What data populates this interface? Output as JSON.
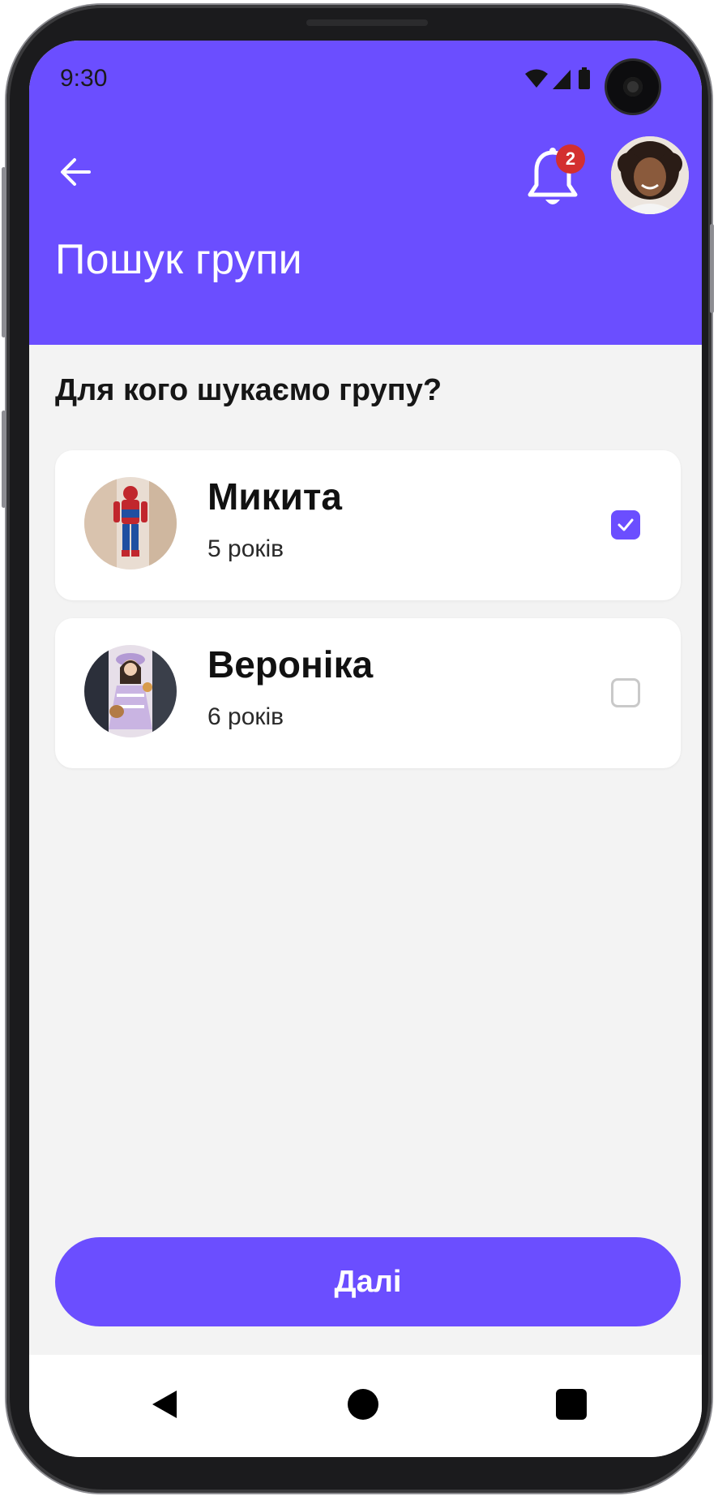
{
  "status_bar": {
    "time": "9:30",
    "icons": [
      "wifi-icon",
      "signal-icon",
      "battery-icon"
    ]
  },
  "header": {
    "title": "Пошук групи",
    "notification_count": "2",
    "background_color": "#6b4eff"
  },
  "content": {
    "question": "Для кого шукаємо групу?",
    "children": [
      {
        "name": "Микита",
        "age": "5 років",
        "selected": true
      },
      {
        "name": "Вероніка",
        "age": "6 років",
        "selected": false
      }
    ]
  },
  "footer": {
    "next_label": "Далі",
    "accent_color": "#6b4eff"
  },
  "navbar": {
    "icons": [
      "nav-back-icon",
      "nav-home-icon",
      "nav-recents-icon"
    ]
  }
}
